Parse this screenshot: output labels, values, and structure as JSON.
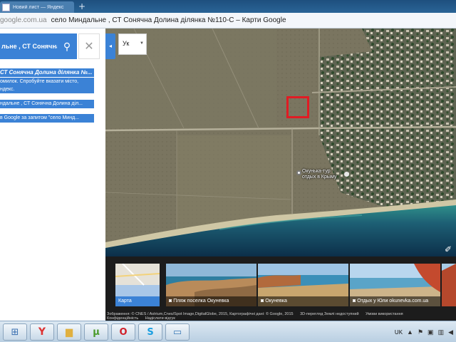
{
  "browser": {
    "tabs": [
      {
        "label": "Новий лист — Яндекс"
      }
    ],
    "new_tab_label": "+",
    "url_domain": "google.com.ua",
    "page_title": "село Миндальне , СТ Сонячна Долина ділянка №110-С – Карти Google"
  },
  "search": {
    "query": "льне , СТ Сонячна",
    "clear_label": "✕",
    "collapse_label": "◂",
    "language": "Ук"
  },
  "result": {
    "title": "СТ Сонячна Долина ділянка №...",
    "desc_line1": "омилок. Спробуйте вказати місто,",
    "desc_line2": "ндекс.",
    "suggestion": "ндальне , СТ Сонячна Долина діл...",
    "query_text": "в Google за запитом \"село Минд..."
  },
  "map": {
    "pin_label_line1": "Окунька-тур",
    "pin_label_line2": "отдых в Крыму"
  },
  "photos": [
    {
      "caption": "Карта"
    },
    {
      "caption": "Пляж поселка Окуневка"
    },
    {
      "caption": "Окуневка"
    },
    {
      "caption": "Отдых у Юли okunevka.com.ua"
    }
  ],
  "attribution": {
    "imagery": "Зображення: © CNES / Astrium,Cnes/Spot Image,DigitalGlobe, 2015, Картографічні дані: © Google, 2015",
    "report": "3D-перегляд Землі недоступний",
    "terms": "Умови використання",
    "privacy": "Конфіденційність",
    "feedback": "Надіслати відгук"
  },
  "taskbar": {
    "tray_lang": "UK"
  },
  "colors": {
    "accent": "#3b82d6",
    "highlight": "#e01c24"
  }
}
